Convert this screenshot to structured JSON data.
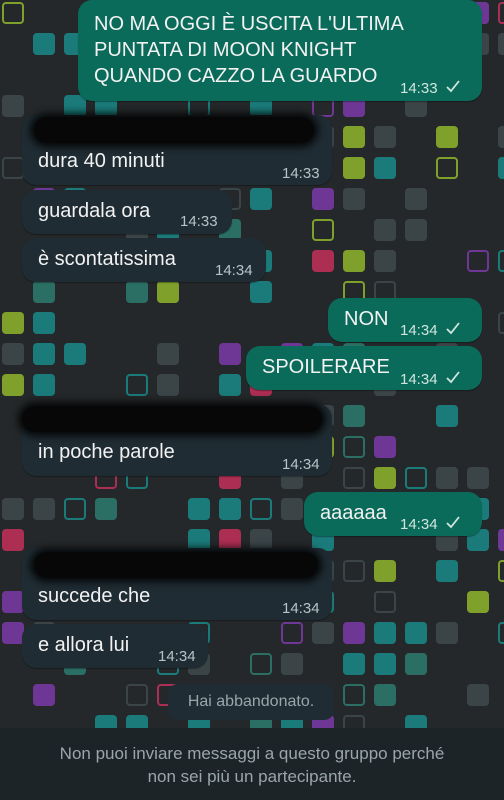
{
  "messages": [
    {
      "id": "m1",
      "dir": "out",
      "lines": [
        "NO MA OGGI È USCITA L'ULTIMA",
        "PUNTATA DI MOON KNIGHT",
        "QUANDO CAZZO LA GUARDO"
      ],
      "time": "14:33",
      "read": true
    },
    {
      "id": "m2",
      "dir": "in",
      "sender_hidden": true,
      "text": "dura 40 minuti",
      "time": "14:33"
    },
    {
      "id": "m3",
      "dir": "in",
      "text": "guardala ora",
      "time": "14:33"
    },
    {
      "id": "m4",
      "dir": "in",
      "text": "è scontatissima",
      "time": "14:34"
    },
    {
      "id": "m5",
      "dir": "out",
      "text": "NON",
      "time": "14:34",
      "read": true
    },
    {
      "id": "m6",
      "dir": "out",
      "text": "SPOILERARE",
      "time": "14:34",
      "read": true
    },
    {
      "id": "m7",
      "dir": "in",
      "sender_hidden": true,
      "text": "in poche parole",
      "time": "14:34"
    },
    {
      "id": "m8",
      "dir": "out",
      "text": "aaaaaa",
      "time": "14:34",
      "read": true
    },
    {
      "id": "m9",
      "dir": "in",
      "sender_hidden": true,
      "text": "succede che",
      "time": "14:34"
    },
    {
      "id": "m10",
      "dir": "in",
      "text": "e allora lui",
      "time": "14:34"
    }
  ],
  "system_message": "Hai abbandonato.",
  "footer": {
    "lines": [
      "Non puoi inviare messaggi a questo gruppo perché",
      "non sei più un partecipante."
    ]
  },
  "icons": {
    "read_receipt": "single-check-icon"
  },
  "colors": {
    "outgoing": "#0b6b5a",
    "incoming": "#1f2c33",
    "background": "#25282a"
  }
}
